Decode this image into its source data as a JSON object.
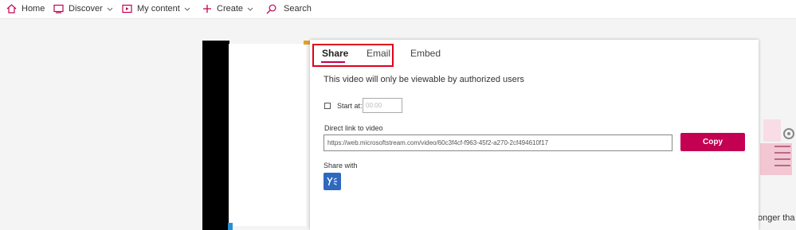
{
  "nav": {
    "home": "Home",
    "discover": "Discover",
    "my_content": "My content",
    "create": "Create",
    "search": "Search"
  },
  "modal": {
    "tabs": {
      "share": "Share",
      "email": "Email",
      "embed": "Embed"
    },
    "notice": "This video will only be viewable by authorized users",
    "start_at_label": "Start at:",
    "start_at_value": "00:00",
    "direct_link_label": "Direct link to video",
    "direct_link_value": "https://web.microsoftstream.com/video/60c3f4cf-f963-45f2-a270-2cf494610f17",
    "copy_label": "Copy",
    "share_with_label": "Share with",
    "share_services": [
      "yammer-icon"
    ]
  },
  "background": {
    "right_text": "onger tha"
  },
  "colors": {
    "accent": "#c30052",
    "highlight": "#e0001b",
    "yammer": "#2f68bf"
  }
}
